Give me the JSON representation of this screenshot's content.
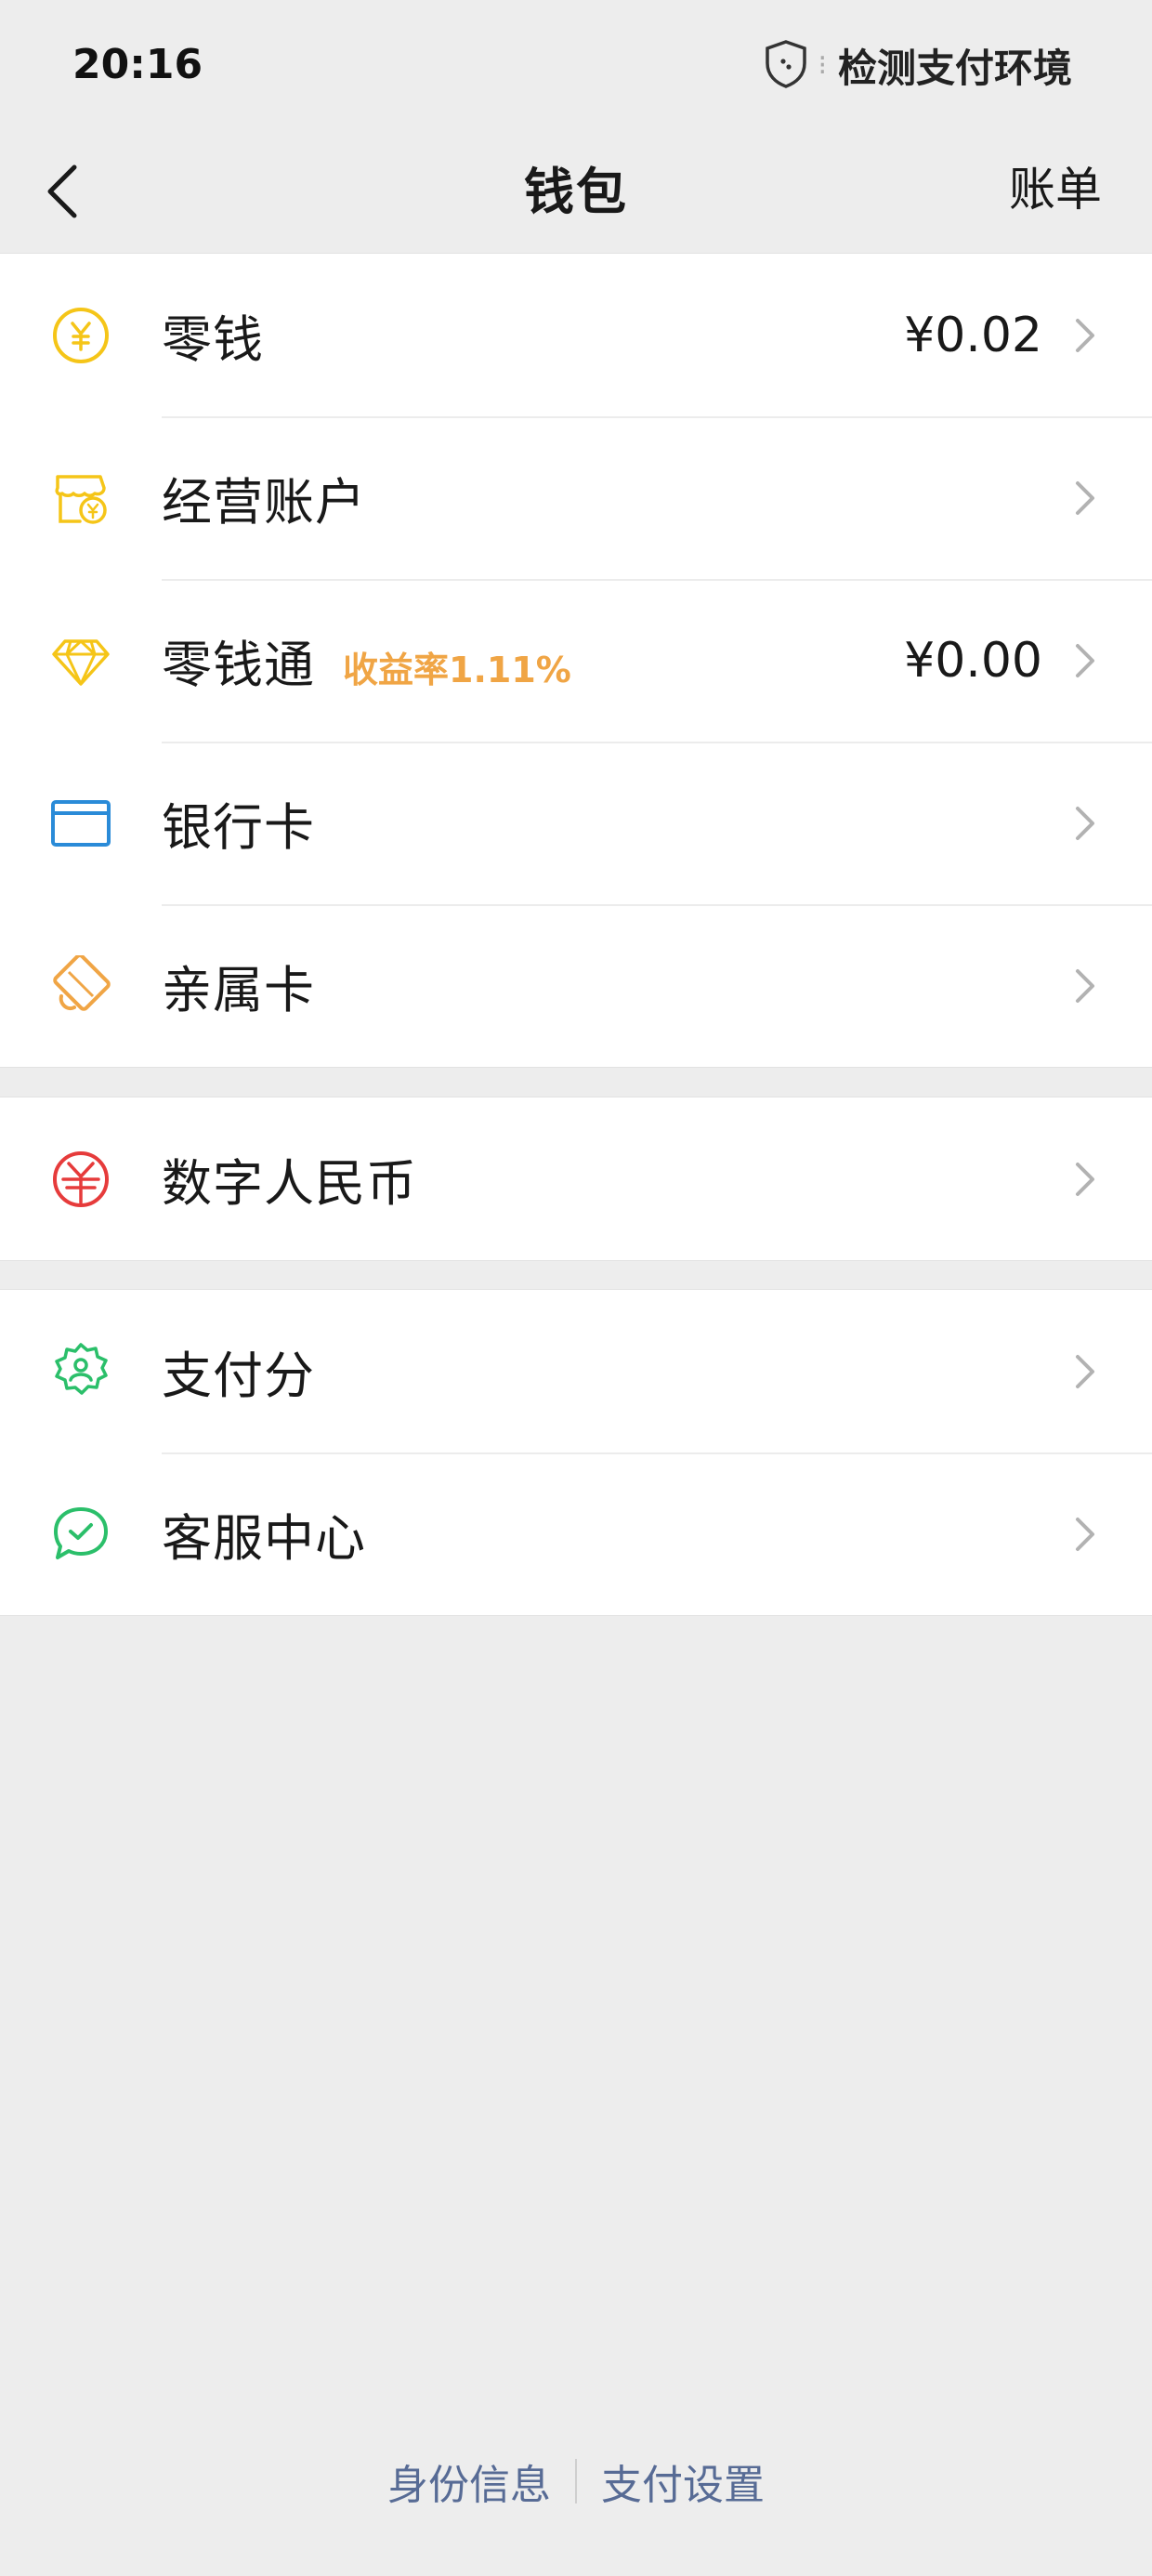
{
  "status_bar": {
    "time": "20:16",
    "indicator": "检测支付环境",
    "icons": [
      "shield-icon"
    ]
  },
  "nav": {
    "title": "钱包",
    "action": "账单",
    "back_icon": "chevron-left-icon"
  },
  "groups": [
    {
      "items": [
        {
          "name": "change",
          "label": "零钱",
          "value": "¥0.02",
          "icon": "yen-coin-icon",
          "color": "#f5c518"
        },
        {
          "name": "business-account",
          "label": "经营账户",
          "value": "",
          "icon": "shop-icon",
          "color": "#f5c518"
        },
        {
          "name": "lingqiantong",
          "label": "零钱通",
          "badge": "收益率1.11%",
          "value": "¥0.00",
          "icon": "diamond-icon",
          "color": "#f5c518"
        },
        {
          "name": "bank-card",
          "label": "银行卡",
          "value": "",
          "icon": "card-icon",
          "color": "#2a8bd8"
        },
        {
          "name": "family-card",
          "label": "亲属卡",
          "value": "",
          "icon": "family-card-icon",
          "color": "#f0a545"
        }
      ]
    },
    {
      "items": [
        {
          "name": "digital-rmb",
          "label": "数字人民币",
          "value": "",
          "icon": "digital-rmb-icon",
          "color": "#e63b3b"
        }
      ]
    },
    {
      "items": [
        {
          "name": "pay-score",
          "label": "支付分",
          "value": "",
          "icon": "badge-user-icon",
          "color": "#2bbf6a"
        },
        {
          "name": "customer-service",
          "label": "客服中心",
          "value": "",
          "icon": "chat-check-icon",
          "color": "#2bbf6a"
        }
      ]
    }
  ],
  "footer": {
    "identity": "身份信息",
    "settings": "支付设置"
  }
}
